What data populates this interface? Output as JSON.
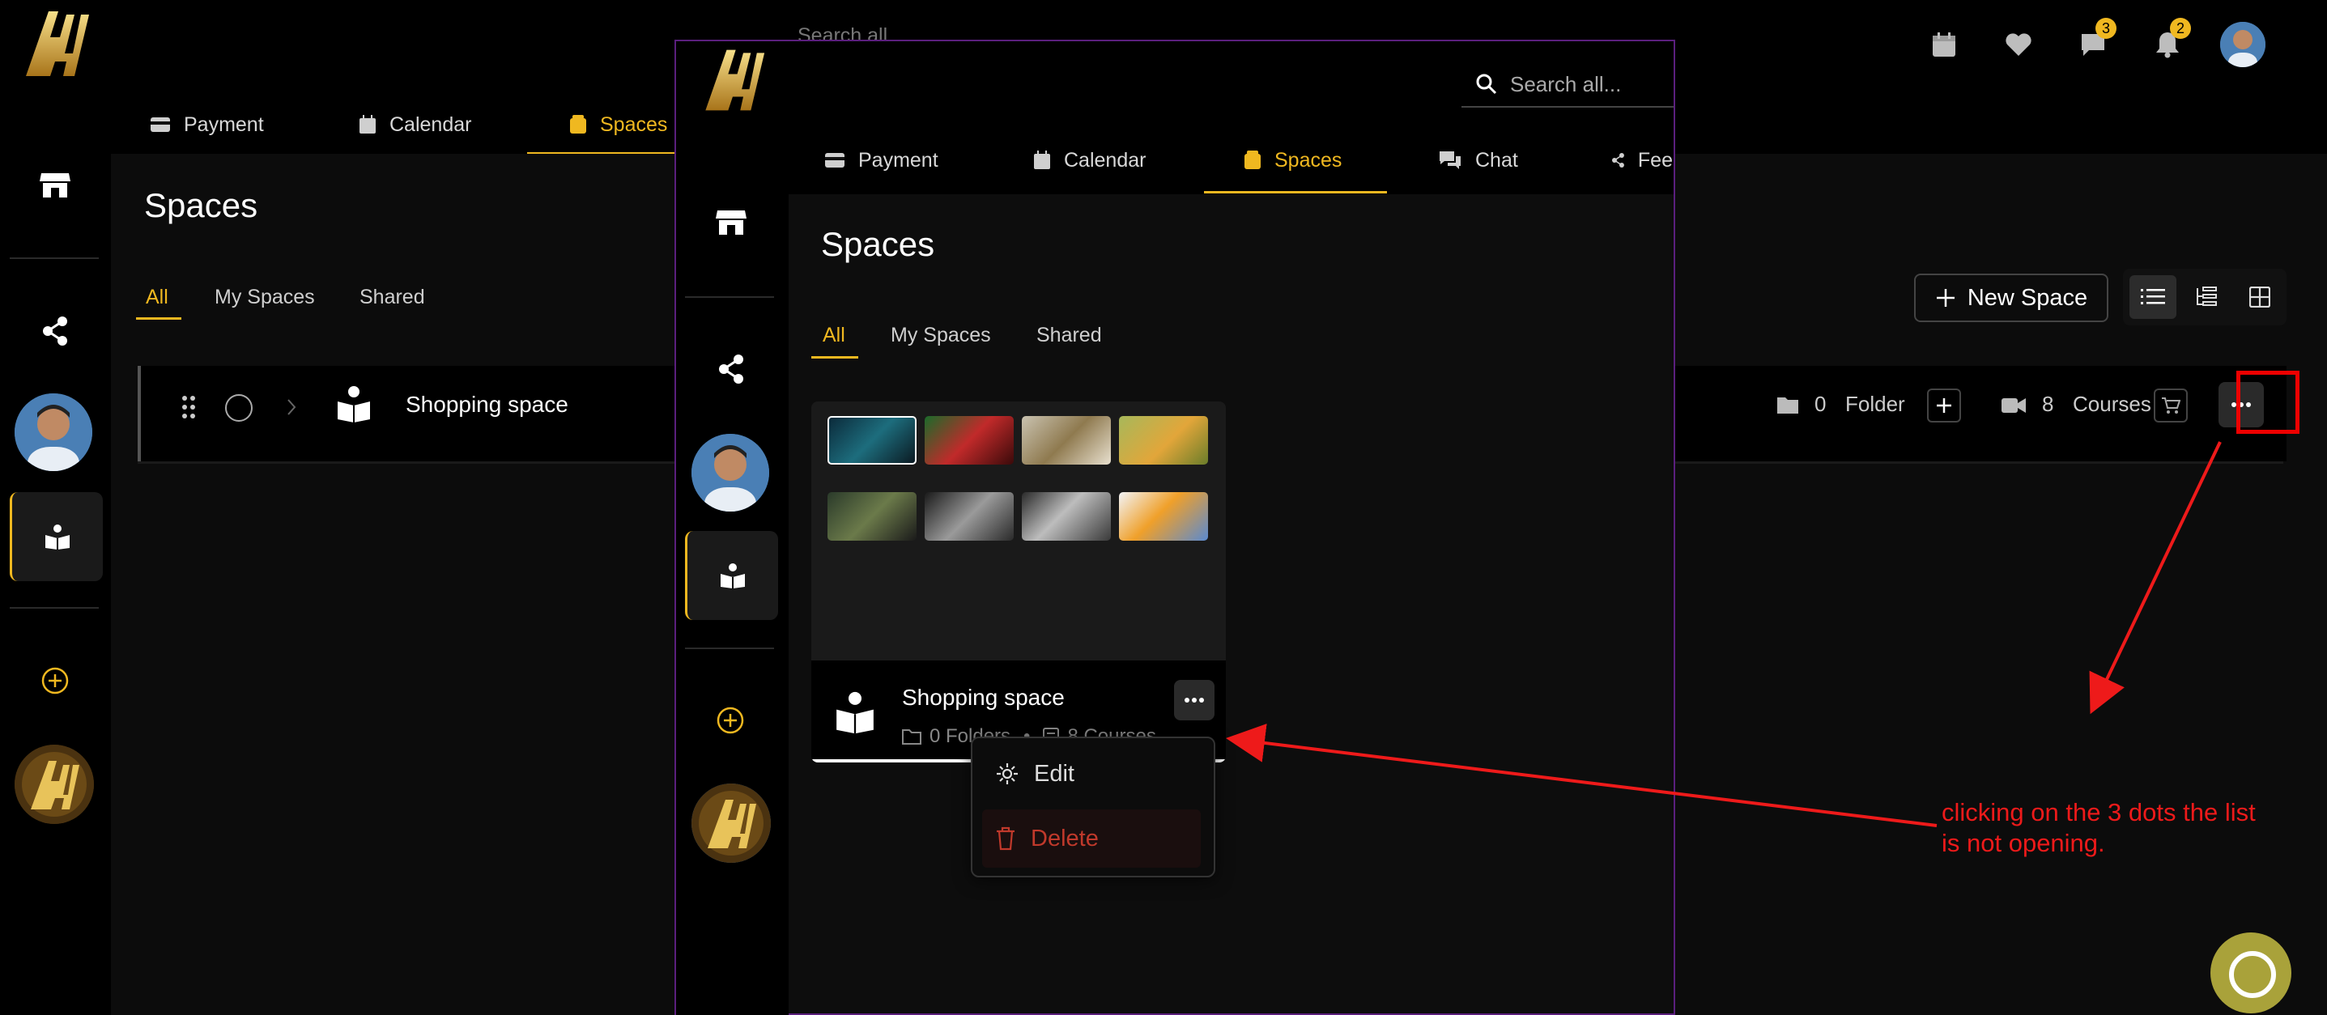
{
  "background_app": {
    "search_placeholder": "Search all...",
    "tabs": [
      {
        "label": "Payment",
        "icon": "card-icon"
      },
      {
        "label": "Calendar",
        "icon": "calendar-icon"
      },
      {
        "label": "Spaces",
        "icon": "spaces-icon",
        "active": true
      }
    ],
    "header": {
      "chat_badge": "3",
      "notification_badge": "2"
    },
    "page_title": "Spaces",
    "subtabs": [
      {
        "label": "All",
        "active": true
      },
      {
        "label": "My Spaces"
      },
      {
        "label": "Shared"
      }
    ],
    "new_space_label": "New Space",
    "space_row": {
      "name": "Shopping space",
      "folder_count": "0",
      "folder_label": "Folder",
      "course_count": "8",
      "course_label": "Courses"
    }
  },
  "overlay_window": {
    "search_placeholder": "Search all...",
    "tabs": [
      {
        "label": "Payment"
      },
      {
        "label": "Calendar"
      },
      {
        "label": "Spaces",
        "active": true
      },
      {
        "label": "Chat"
      },
      {
        "label": "Fee"
      }
    ],
    "page_title": "Spaces",
    "subtabs": [
      {
        "label": "All",
        "active": true
      },
      {
        "label": "My Spaces"
      },
      {
        "label": "Shared"
      }
    ],
    "card": {
      "name": "Shopping space",
      "folders_text": "0 Folders",
      "courses_text": "8 Courses"
    },
    "context_menu": {
      "edit_label": "Edit",
      "delete_label": "Delete"
    }
  },
  "annotation": {
    "line1": "clicking on the 3 dots the list",
    "line2": "is not opening.",
    "color": "#ee1a1a"
  },
  "colors": {
    "accent": "#f0b820",
    "danger": "#c0392b",
    "window_border": "#5a1f7d"
  }
}
